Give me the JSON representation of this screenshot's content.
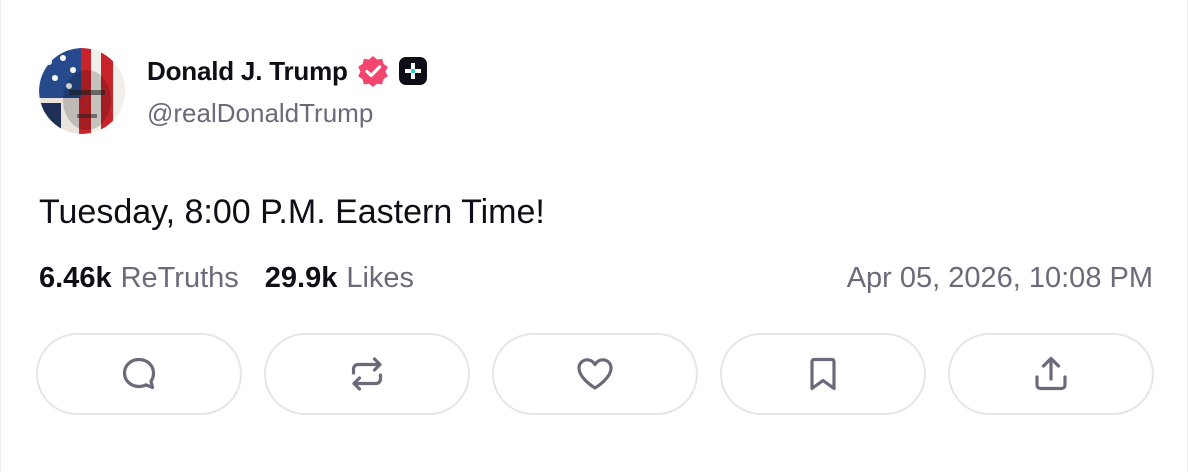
{
  "author": {
    "display_name": "Donald J. Trump",
    "handle": "@realDonaldTrump",
    "verified_icon": "verified-badge-icon",
    "verified_color": "#f2466e",
    "plus_badge_icon": "plus-badge-icon"
  },
  "post": {
    "text": "Tuesday, 8:00 P.M. Eastern Time!"
  },
  "stats": {
    "retruths_count": "6.46k",
    "retruths_label": "ReTruths",
    "likes_count": "29.9k",
    "likes_label": "Likes",
    "timestamp": "Apr 05, 2026, 10:08 PM"
  },
  "actions": [
    {
      "name": "reply",
      "icon": "comment-icon"
    },
    {
      "name": "retruth",
      "icon": "repost-icon"
    },
    {
      "name": "like",
      "icon": "heart-icon"
    },
    {
      "name": "bookmark",
      "icon": "bookmark-icon"
    },
    {
      "name": "share",
      "icon": "share-icon"
    }
  ],
  "colors": {
    "text_primary": "#0f0e16",
    "text_secondary": "#6b6a7a",
    "button_border": "#e5e5ea",
    "icon_gray": "#6b6a7a"
  }
}
